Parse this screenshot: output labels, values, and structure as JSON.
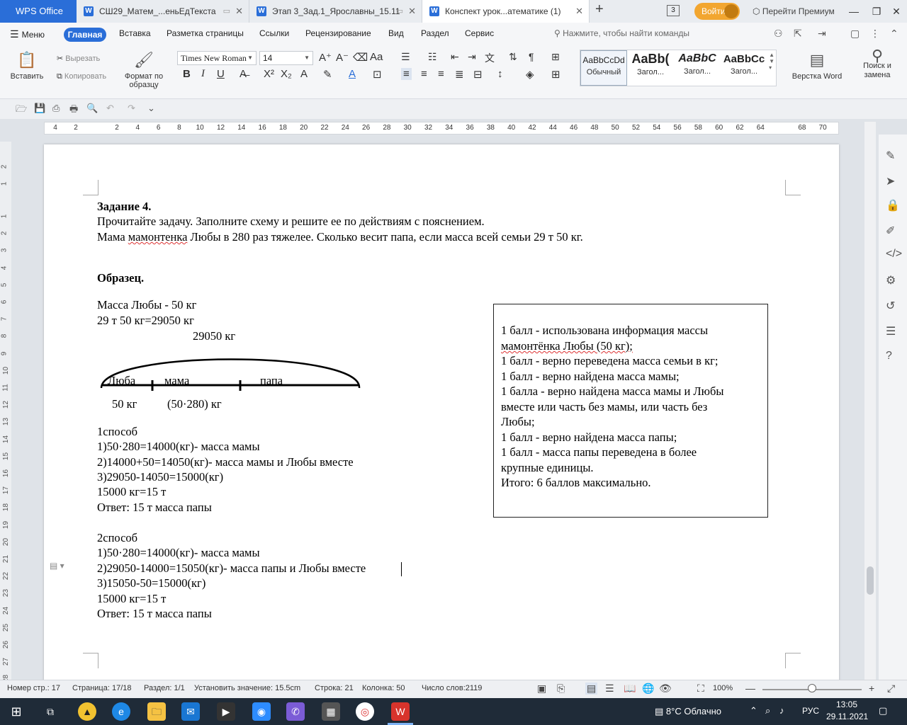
{
  "titlebar": {
    "app_name": "WPS Office",
    "tabs": [
      {
        "label": "СШ29_Матем_...еньЕдТекста"
      },
      {
        "label": "Этап 3_Зад.1_Ярославны_15.11"
      },
      {
        "label": "Конспект урок...атематике (1)"
      }
    ],
    "tab_count": "3",
    "login_label": "Войти",
    "premium_label": "Перейти Премиум"
  },
  "menubar": {
    "menu_label": "Меню",
    "items": [
      "Главная",
      "Вставка",
      "Разметка страницы",
      "Ссылки",
      "Рецензирование",
      "Вид",
      "Раздел",
      "Сервис"
    ],
    "search_placeholder": "Нажмите, чтобы найти команды"
  },
  "ribbon": {
    "paste": "Вставить",
    "cut": "Вырезать",
    "copy": "Копировать",
    "format_painter": "Формат по образцу",
    "font_name": "Times New Roman",
    "font_size": "14",
    "styles": [
      {
        "preview": "AaBbCcDd",
        "label": "Обычный"
      },
      {
        "preview": "AaBb(",
        "label": "Загол..."
      },
      {
        "preview": "AaBbC",
        "label": "Загол..."
      },
      {
        "preview": "AaBbCc",
        "label": "Загол..."
      }
    ],
    "layout_word": "Верстка Word",
    "find_replace_1": "Поиск и",
    "find_replace_2": "замена"
  },
  "ruler": {
    "labels": [
      "4",
      "2",
      "2",
      "4",
      "6",
      "8",
      "10",
      "12",
      "14",
      "16",
      "18",
      "20",
      "22",
      "24",
      "26",
      "28",
      "30",
      "32",
      "34",
      "36",
      "38",
      "40",
      "42",
      "44",
      "46",
      "48",
      "50",
      "52",
      "54",
      "56",
      "58",
      "60",
      "62",
      "64",
      "68",
      "70"
    ],
    "vlabels": [
      "2",
      "1",
      "1",
      "2",
      "3",
      "4",
      "5",
      "6",
      "7",
      "8",
      "9",
      "10",
      "11",
      "12",
      "13",
      "14",
      "15",
      "16",
      "17",
      "18",
      "19",
      "20",
      "21",
      "22",
      "23",
      "24",
      "25",
      "26",
      "27",
      "28"
    ]
  },
  "document": {
    "task_title": "Задание 4.",
    "instruction": "Прочитайте задачу. Заполните схему и решите ее по действиям с пояснением.",
    "problem_pre": "Мама ",
    "problem_squiggle": "мамонтенка",
    "problem_post": " Любы в 280 раз тяжелее. Сколько весит папа, если масса всей семьи 29 т 50 кг.",
    "sample_title": "Образец.",
    "line_mass_lyuba": "Масса Любы - 50 кг",
    "line_convert": "29 т 50 кг=29050 кг",
    "diagram": {
      "total": "29050 кг",
      "seg1": "Люба",
      "seg2": "мама",
      "seg3": "папа",
      "val1": "50 кг",
      "val2": "(50·280) кг"
    },
    "method1": [
      "1способ",
      "1)50·280=14000(кг)- масса мамы",
      "2)14000+50=14050(кг)- масса мамы и Любы вместе",
      "3)29050-14050=15000(кг)",
      "15000 кг=15 т",
      "Ответ: 15 т масса папы"
    ],
    "method2": [
      "2способ",
      "1)50·280=14000(кг)- масса мамы",
      "2)29050-14000=15050(кг)- масса папы и Любы вместе",
      "3)15050-50=15000(кг)",
      "15000 кг=15 т",
      "Ответ: 15 т масса папы"
    ],
    "scoring": [
      "1 балл - использована информация массы",
      "мамонтёнка Любы (50 кг);",
      "1 балл - верно переведена масса семьи в кг;",
      "1 балл - верно найдена масса мамы;",
      "1 балла - верно найдена масса мамы и Любы",
      "вместе или часть без мамы, или часть без",
      "Любы;",
      "1 балл - верно найдена масса папы;",
      "1 балл - масса папы переведена в более",
      "крупные единицы.",
      "Итого: 6 баллов максимально."
    ]
  },
  "statusbar": {
    "page_no": "Номер стр.: 17",
    "page": "Страница: 17/18",
    "section": "Раздел: 1/1",
    "set_value": "Установить значение: 15.5cm",
    "row": "Строка: 21",
    "column": "Колонка: 50",
    "word_count": "Число слов:2119",
    "zoom": "100%"
  },
  "taskbar": {
    "weather": "8°C  Облачно",
    "lang": "РУС",
    "time": "13:05",
    "date": "29.11.2021"
  },
  "colors": {
    "accent": "#2a6ed8",
    "login": "#f2a630",
    "taskbar": "#1f2b38"
  }
}
